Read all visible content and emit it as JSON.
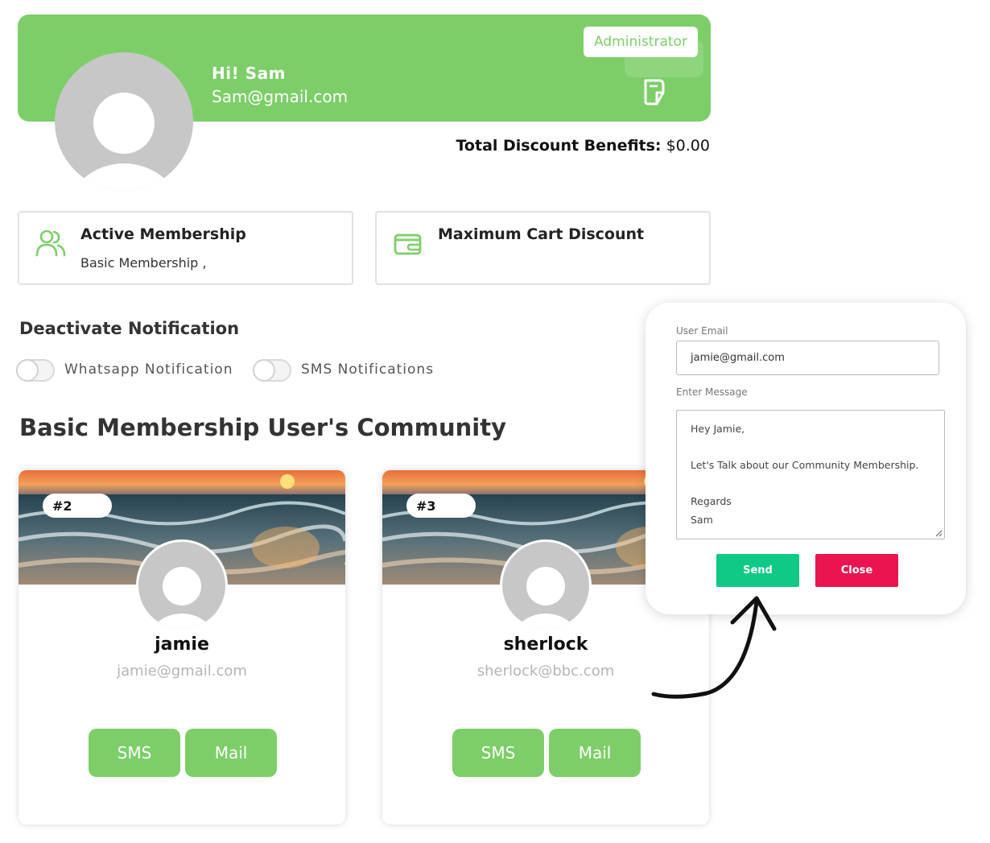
{
  "header": {
    "role_badge": "Administrator",
    "greeting": "Hi! Sam",
    "email": "Sam@gmail.com",
    "edit_icon": "edit-document-icon",
    "avatar_icon": "user-avatar-placeholder"
  },
  "discount": {
    "label": "Total Discount Benefits:",
    "value": "$0.00"
  },
  "cards": {
    "membership": {
      "icon": "users-icon",
      "title": "Active Membership",
      "subtitle": "Basic Membership ,"
    },
    "cart_discount": {
      "icon": "wallet-icon",
      "title": "Maximum Cart Discount"
    }
  },
  "notifications": {
    "heading": "Deactivate Notification",
    "whatsapp_label": "Whatsapp Notification",
    "sms_label": "SMS Notifications"
  },
  "community": {
    "heading": "Basic Membership User's Community",
    "members": [
      {
        "rank": "#2",
        "name": "jamie",
        "email": "jamie@gmail.com",
        "sms_label": "SMS",
        "mail_label": "Mail"
      },
      {
        "rank": "#3",
        "name": "sherlock",
        "email": "sherlock@bbc.com",
        "sms_label": "SMS",
        "mail_label": "Mail"
      }
    ]
  },
  "modal": {
    "email_label": "User Email",
    "email_value": "jamie@gmail.com",
    "message_label": "Enter Message",
    "message_lines": [
      "Hey Jamie,",
      "",
      "Let's Talk about our Community Membership.",
      "",
      "Regards",
      "Sam"
    ],
    "send_label": "Send",
    "close_label": "Close"
  },
  "colors": {
    "brand_green": "#7dce69",
    "send_green": "#0fc985",
    "close_red": "#ea1550"
  }
}
